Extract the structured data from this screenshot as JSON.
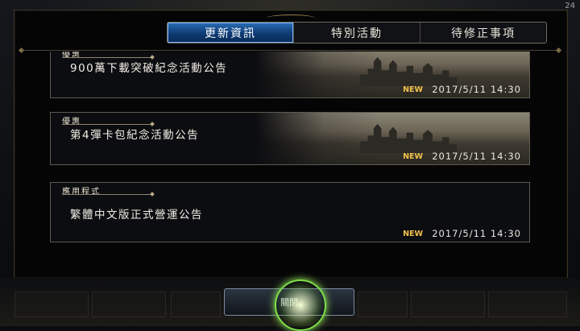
{
  "tabs": [
    {
      "label": "更新資訊",
      "active": true
    },
    {
      "label": "特別活動",
      "active": false
    },
    {
      "label": "待修正事項",
      "active": false
    }
  ],
  "status_text": "24",
  "news": [
    {
      "category": "優惠",
      "title": "900萬下載突破紀念活動公告",
      "new_label": "NEW",
      "date": "2017/5/11  14:30",
      "has_image": true
    },
    {
      "category": "優惠",
      "title": "第4彈卡包紀念活動公告",
      "new_label": "NEW",
      "date": "2017/5/11  14:30",
      "has_image": true
    },
    {
      "category": "應用程式",
      "title": "繁體中文版正式營運公告",
      "new_label": "NEW",
      "date": "2017/5/11  14:30",
      "has_image": false
    }
  ],
  "bottom_nav": {
    "center_label": "關閉"
  },
  "colors": {
    "accent": "#2a6fb8",
    "new_badge": "#f2c14a",
    "frame": "#5e5a50"
  }
}
